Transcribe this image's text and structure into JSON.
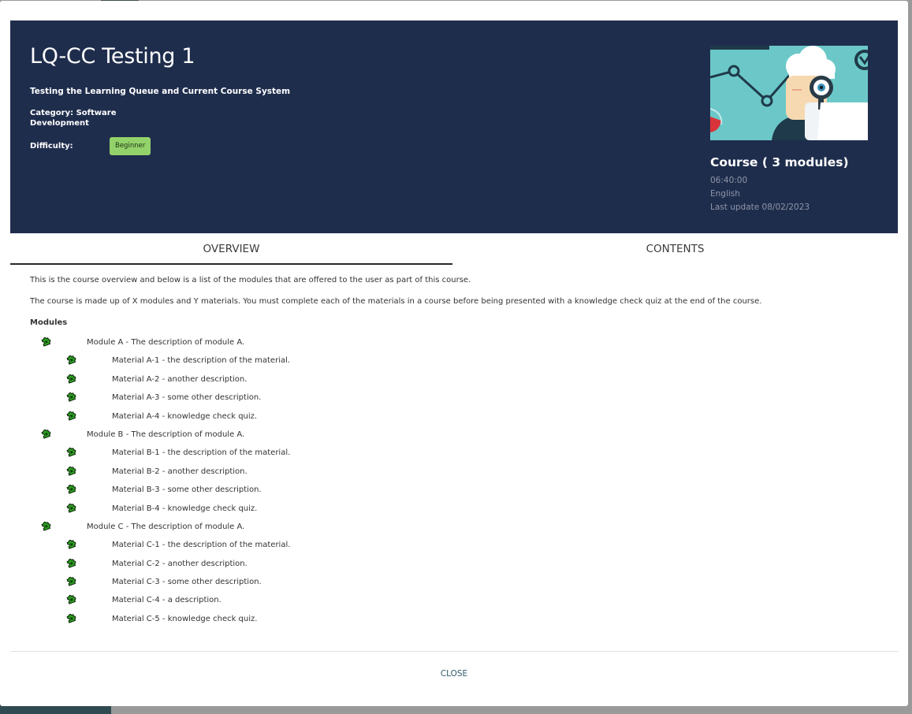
{
  "course": {
    "title": "LQ-CC Testing 1",
    "subtitle": "Testing the Learning Queue and Current Course System",
    "category": "Category: Software Development",
    "difficulty_label": "Difficulty:",
    "difficulty_value": "Beginner"
  },
  "meta": {
    "title": "Course ( 3 modules)",
    "duration": "06:40:00",
    "language": "English",
    "last_update": "Last update 08/02/2023"
  },
  "tabs": [
    {
      "label": "OVERVIEW",
      "active": true
    },
    {
      "label": "CONTENTS",
      "active": false
    }
  ],
  "overview": {
    "intro": "This is the course overview and below is a list of the modules that are offered to the user as part of this course.",
    "details": "The course is made up of X modules and Y materials. You must complete each of the materials in a course before being presented with a knowledge check quiz at the end of the course.",
    "modules_heading": "Modules"
  },
  "tree": [
    {
      "level": 0,
      "text": "Module A - The description of module A."
    },
    {
      "level": 1,
      "text": "Material A-1 - the description of the material."
    },
    {
      "level": 1,
      "text": "Material A-2 - another description."
    },
    {
      "level": 1,
      "text": "Material A-3 - some other description."
    },
    {
      "level": 1,
      "text": "Material A-4 - knowledge check quiz."
    },
    {
      "level": 0,
      "text": "Module B - The description of module A."
    },
    {
      "level": 1,
      "text": "Material B-1 - the description of the material."
    },
    {
      "level": 1,
      "text": "Material B-2 - another description."
    },
    {
      "level": 1,
      "text": "Material B-3 - some other description."
    },
    {
      "level": 1,
      "text": "Material B-4 - knowledge check quiz."
    },
    {
      "level": 0,
      "text": "Module C - The description of module A."
    },
    {
      "level": 1,
      "text": "Material C-1 - the description of the material."
    },
    {
      "level": 1,
      "text": "Material C-2 - another description."
    },
    {
      "level": 1,
      "text": "Material C-3 - some other description."
    },
    {
      "level": 1,
      "text": "Material C-4 - a description."
    },
    {
      "level": 1,
      "text": "Material C-5 - knowledge check quiz."
    }
  ],
  "icons": {
    "tree_node": "puzzle-piece-icon"
  },
  "footer": {
    "close_label": "CLOSE"
  },
  "colors": {
    "hero_bg": "#1f2d4d",
    "badge_bg": "#93d26a",
    "puzzle_green": "#2fa321",
    "close_text": "#2f5b6b"
  }
}
